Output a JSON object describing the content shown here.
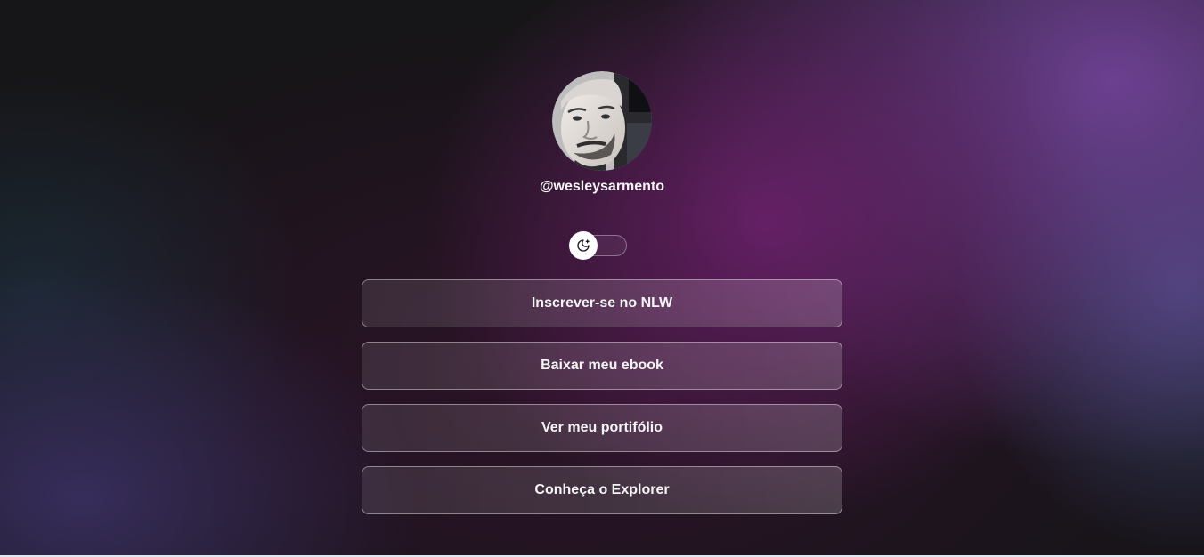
{
  "profile": {
    "avatar_alt": "Foto de perfil",
    "username": "@wesleysarmento"
  },
  "theme_toggle": {
    "icon": "moon-icon",
    "mode": "dark"
  },
  "links": [
    {
      "label": "Inscrever-se no NLW"
    },
    {
      "label": "Baixar meu ebook"
    },
    {
      "label": "Ver meu portifólio"
    },
    {
      "label": "Conheça o Explorer"
    }
  ],
  "colors": {
    "text": "#f4f4f5",
    "accent_purple": "#6e216e",
    "knob": "#ffffff"
  }
}
